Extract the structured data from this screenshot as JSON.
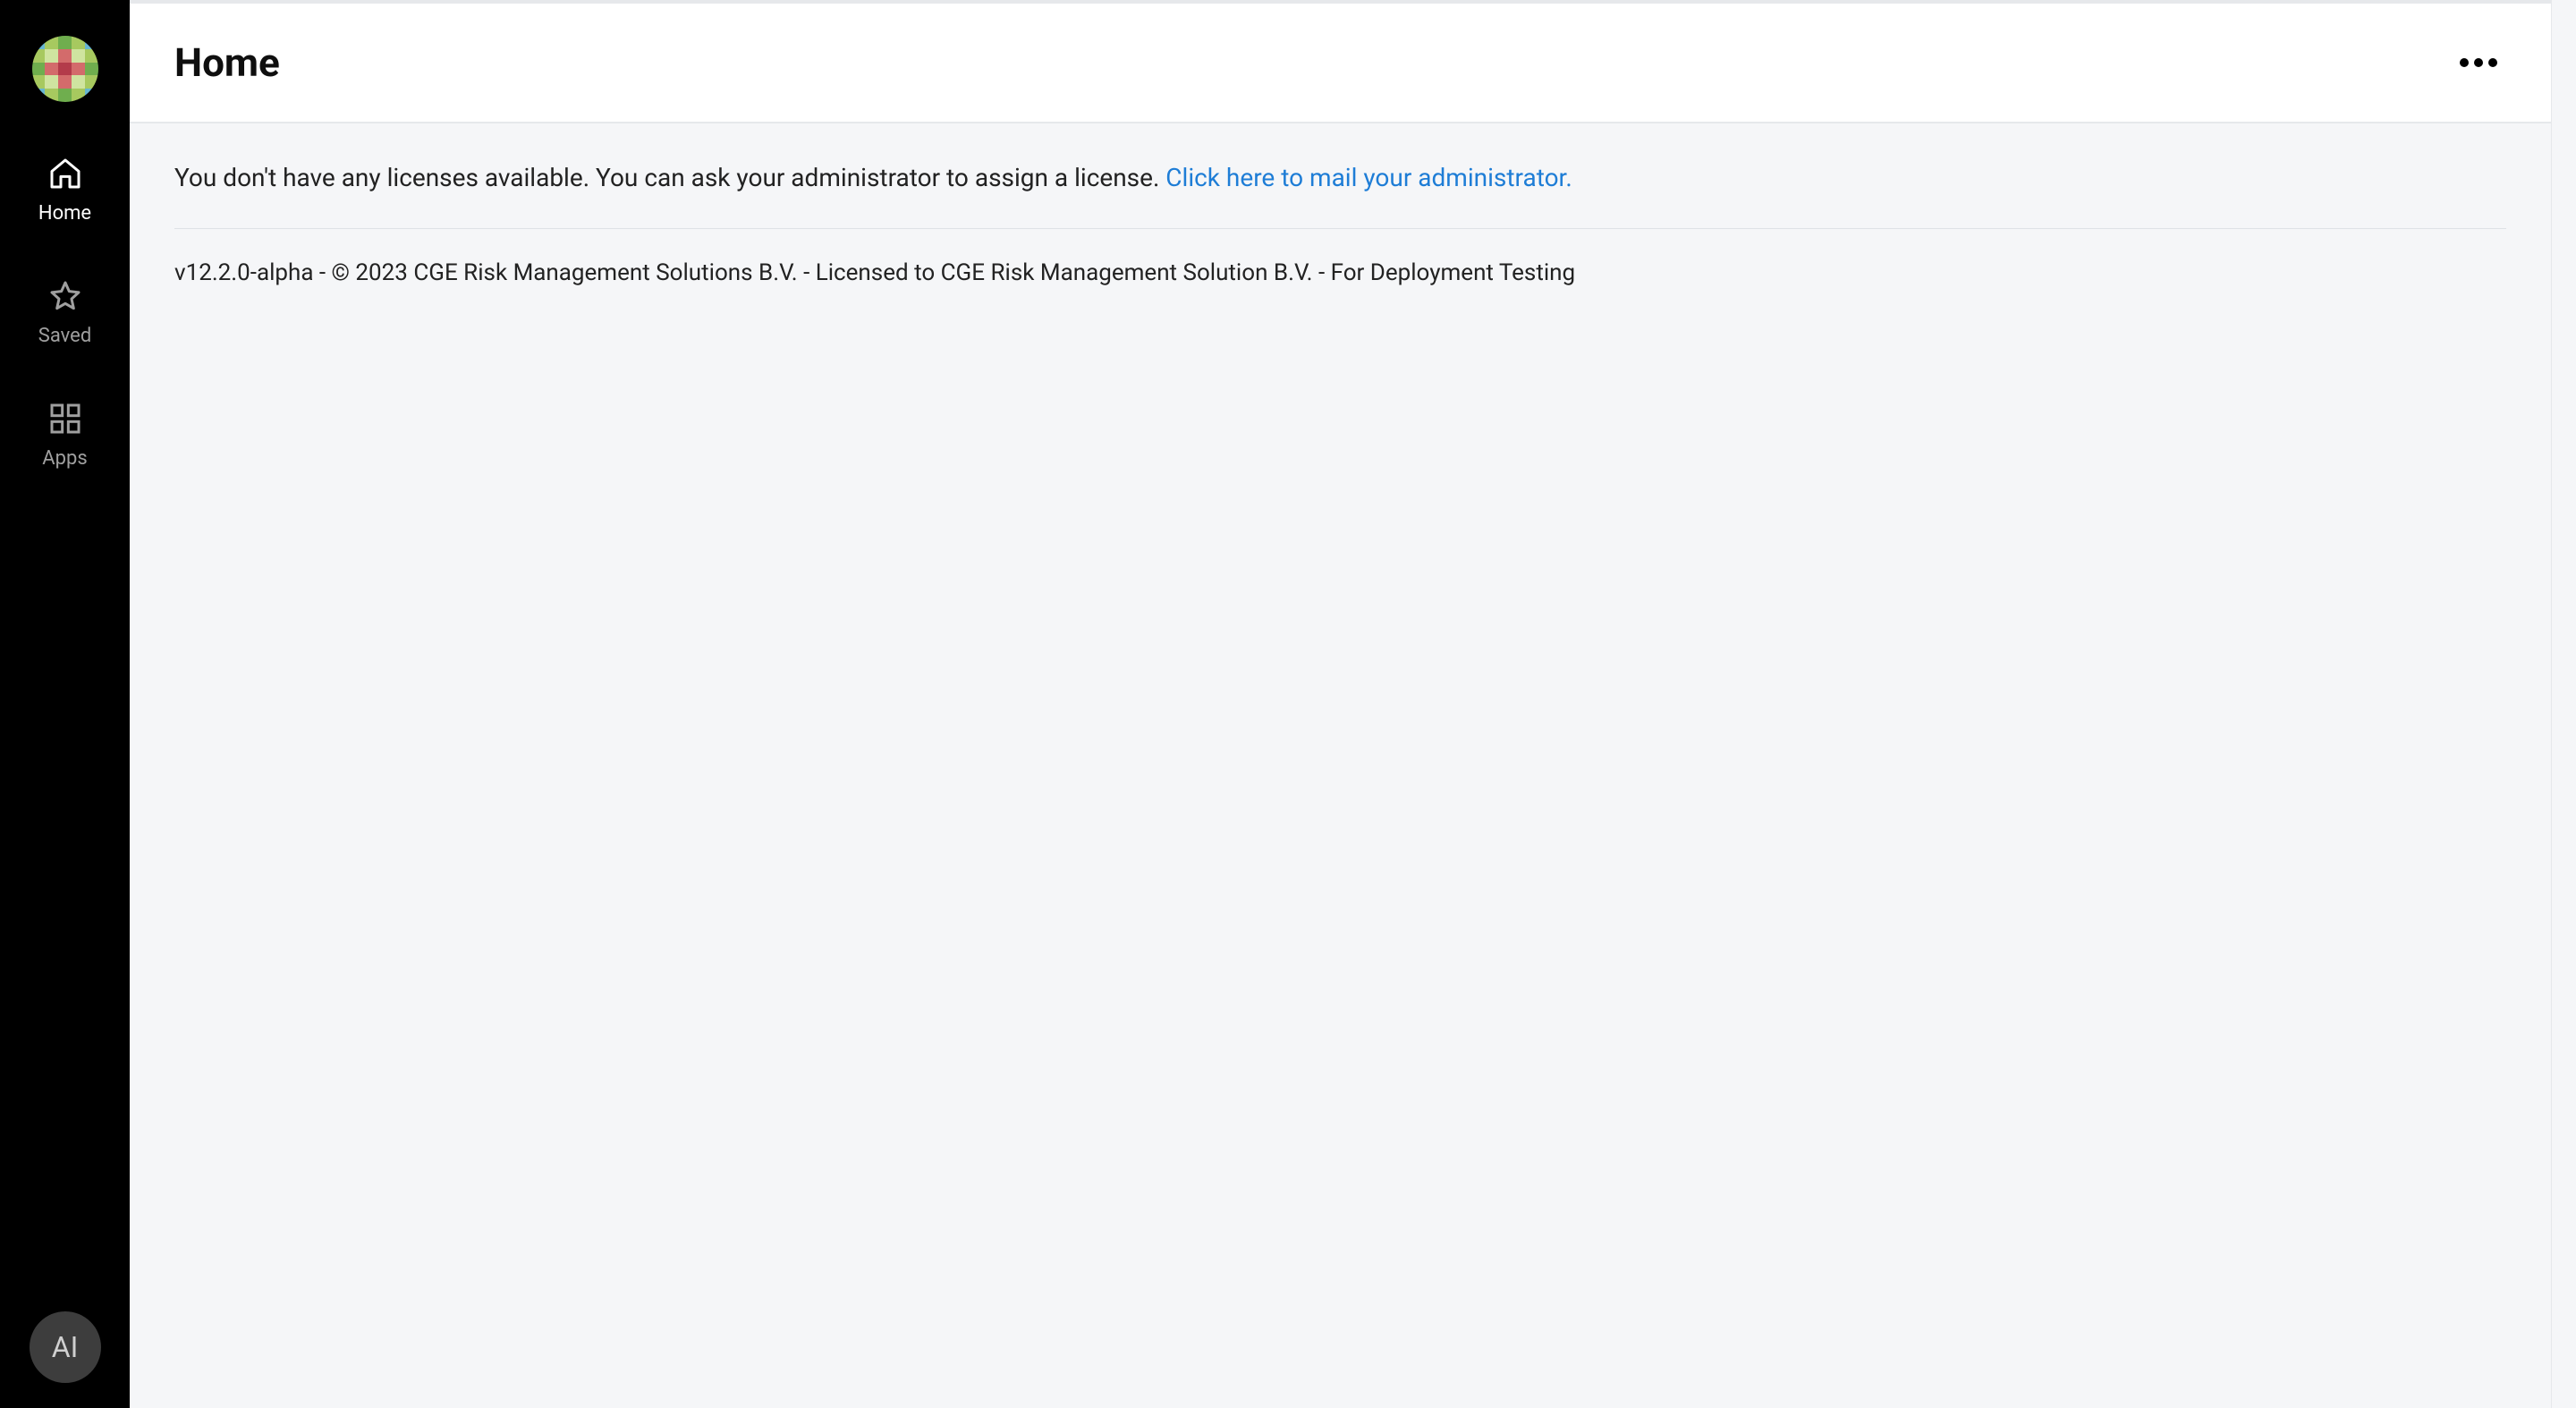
{
  "sidebar": {
    "nav": {
      "home": "Home",
      "saved": "Saved",
      "apps": "Apps"
    },
    "avatar_initials": "AI"
  },
  "header": {
    "title": "Home"
  },
  "notice": {
    "text": "You don't have any licenses available. You can ask your administrator to assign a license. ",
    "link_text": "Click here to mail your administrator."
  },
  "footer": {
    "text": "v12.2.0-alpha - © 2023 CGE Risk Management Solutions B.V. - Licensed to CGE Risk Management Solution B.V. - For Deployment Testing"
  }
}
